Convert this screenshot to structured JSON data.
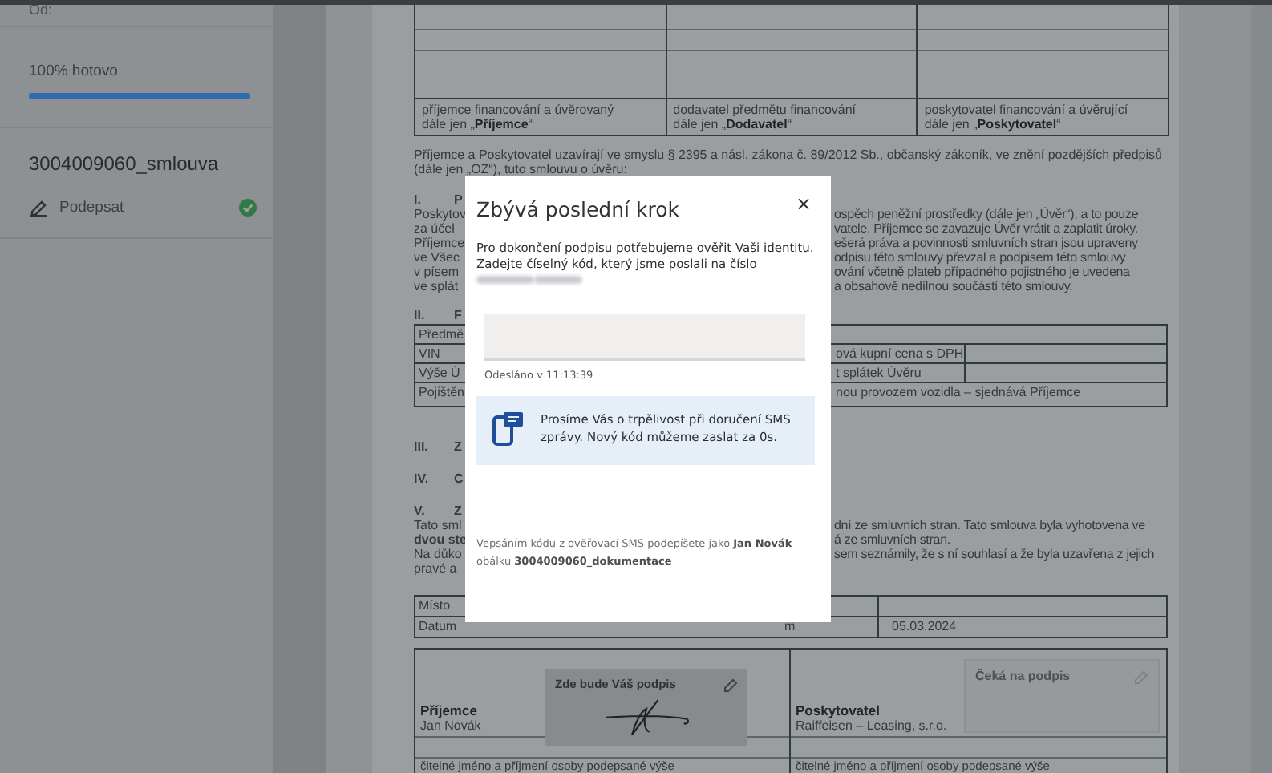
{
  "sidebar": {
    "from_label": "Od:",
    "progress": {
      "label": "100% hotovo",
      "level": 1
    },
    "document_name": "3004009060_smlouva",
    "steps": [
      {
        "label": "Podepsat",
        "done": true
      }
    ]
  },
  "document": {
    "party_table": [
      {
        "role": "příjemce financování a úvěrovaný",
        "alias": "dále jen „**Příjemce**“"
      },
      {
        "role": "dodavatel předmětu financování",
        "alias": "dále jen „**Dodavatel**“"
      },
      {
        "role": "poskytovatel financování a úvěrující",
        "alias": "dále jen „**Poskytovatel**“"
      }
    ],
    "intro": "Příjemce a Poskytovatel uzavírají ve smyslu § 2395 a násl. zákona č. 89/2012 Sb., občanský zákoník, ve znění pozdějších předpisů (dále jen „OZ“), tuto smlouvu o úvěru:",
    "section_1": {
      "number": "I.",
      "title": "P",
      "lines": [
        {
          "left": "Poskytov",
          "right": "ospěch peněžní prostředky (dále jen „Úvěr“), a to pouze"
        },
        {
          "left": "za účel",
          "right": "vatele. Příjemce se zavazuje Úvěr vrátit a zaplatit úroky."
        },
        {
          "left": "Příjemce",
          "right": "ešerá práva a povinnosti smluvních stran jsou upraveny"
        },
        {
          "left": "ve Všec",
          "right": "odpisu této smlouvy převzal a podpisem této smlouvy"
        },
        {
          "left": "v písem",
          "right": "ování včetně plateb případného pojistného je uvedena"
        },
        {
          "left": "ve splát",
          "right": "a obsahově nedílnou součástí této smlouvy."
        }
      ]
    },
    "section_2": {
      "number": "II.",
      "title": "F",
      "rows": [
        {
          "left": "Předmě"
        },
        {
          "left": "VIN",
          "right": "ová kupní cena s DPH",
          "split": true
        },
        {
          "left": "Výše Ú",
          "right": "t splátek Úvěru",
          "split": true
        },
        {
          "left": "Pojištěn",
          "right": "nou provozem vozidla – sjednává Příjemce",
          "split": false
        }
      ]
    },
    "sections": [
      {
        "number": "III.",
        "title": "Z"
      },
      {
        "number": "IV.",
        "title": "C"
      },
      {
        "number": "V.",
        "title": "Z"
      }
    ],
    "section_5_lines": [
      {
        "left": "Tato sml",
        "right": "dní ze smluvních stran. Tato smlouva byla vyhotovena ve",
        "bold": false
      },
      {
        "left": "dvou ste",
        "right": "á ze smluvních stran.",
        "bold": true
      },
      {
        "left": "Na důko",
        "right": "sem seznámily, že s ní souhlasí a že byla uzavřena z jejich",
        "bold": false
      },
      {
        "left": "pravé a",
        "bold": false
      }
    ],
    "place_table": [
      {
        "label": "Místo"
      },
      {
        "label": "Datum",
        "right_label": "m",
        "value": "05.03.2024"
      }
    ],
    "signatures": [
      {
        "role": "Příjemce",
        "name": "Jan Novák",
        "box_label": "Zde bude Váš podpis",
        "signed": true,
        "caption": "čitelné jméno a příjmení osoby podepsané výše"
      },
      {
        "role": "Poskytovatel",
        "name": "Raiffeisen – Leasing, s.r.o.",
        "box_label": "Čeká na podpis",
        "signed": false,
        "caption": "čitelné jméno a příjmení osoby podepsané výše"
      }
    ]
  },
  "modal": {
    "title": "Zbývá poslední krok",
    "close": "×",
    "message": "Pro dokončení podpisu potřebujeme ověřit Vaši identitu. Zadejte číselný kód, který jsme poslali na číslo",
    "code_field": {
      "status": "Odesláno v 11:13:39"
    },
    "info": "Prosíme Vás o trpělivost při doručení SMS zprávy. Nový kód můžeme zaslat za 0s.",
    "footer": "Vepsáním kódu z ověřovací SMS podepíšete jako **Jan Novák** obálku **3004009060_dokumentace**"
  }
}
